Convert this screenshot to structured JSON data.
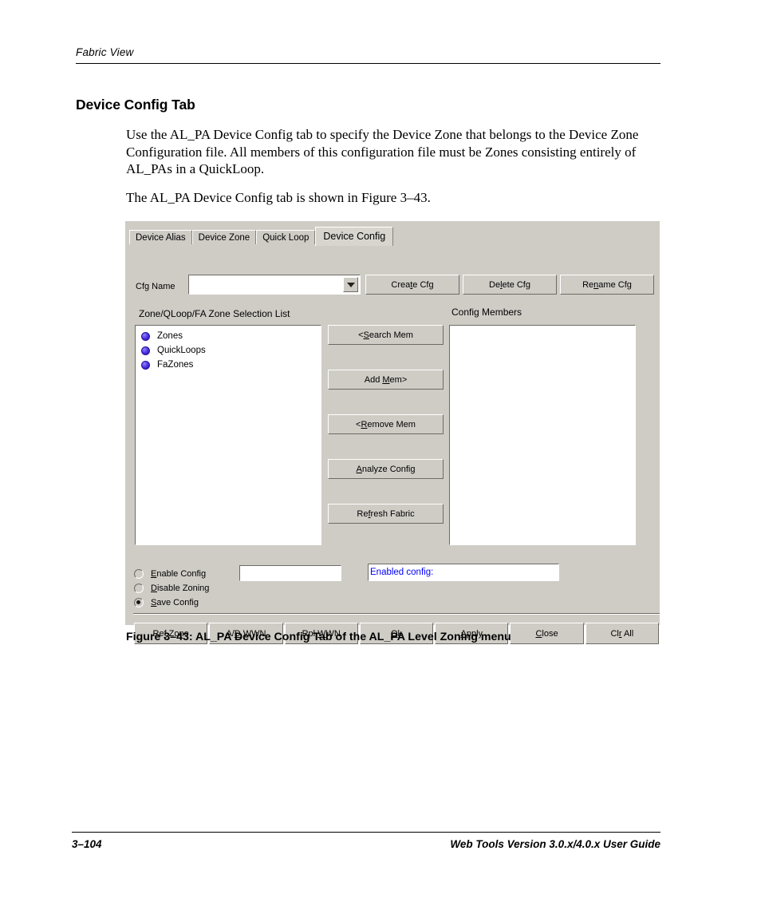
{
  "page": {
    "header": "Fabric View",
    "section_title": "Device Config Tab",
    "paragraphs": [
      "Use the AL_PA Device Config tab to specify the Device Zone that belongs to the Device Zone Configuration file. All members of this configuration file must be Zones consisting entirely of AL_PAs in a QuickLoop.",
      "The AL_PA Device Config tab is shown in Figure 3–43."
    ],
    "figure_caption": "Figure 3–43:  AL_PA Device Config Tab of the AL_PA Level Zoning menu",
    "footer_left": "3–104",
    "footer_right": "Web Tools Version 3.0.x/4.0.x User Guide"
  },
  "dialog": {
    "tabs": [
      {
        "label": "Device Alias",
        "active": false
      },
      {
        "label": "Device Zone",
        "active": false
      },
      {
        "label": "Quick Loop",
        "active": false
      },
      {
        "label": "Device Config",
        "active": true
      }
    ],
    "cfg_name": {
      "label": "Cfg Name",
      "value": "",
      "placeholder": "",
      "dropdown_icon": "chevron-down-icon"
    },
    "top_buttons": [
      {
        "label": "Create Cfg",
        "mnemonic": "t"
      },
      {
        "label": "Delete Cfg",
        "mnemonic": "l"
      },
      {
        "label": "Rename Cfg",
        "mnemonic": "n"
      }
    ],
    "selection_list": {
      "label": "Zone/QLoop/FA Zone Selection List",
      "items": [
        {
          "label": "Zones",
          "icon": "sphere-icon"
        },
        {
          "label": "QuickLoops",
          "icon": "sphere-icon"
        },
        {
          "label": "FaZones",
          "icon": "sphere-icon"
        }
      ]
    },
    "members": {
      "label": "Config Members",
      "items": []
    },
    "middle_buttons": [
      {
        "id": "search",
        "pre": "<",
        "mnemonic": "S",
        "post": "earch Mem"
      },
      {
        "id": "add",
        "pre": "Add ",
        "mnemonic": "M",
        "post": "em>"
      },
      {
        "id": "remove",
        "pre": "<",
        "mnemonic": "R",
        "post": "emove Mem"
      },
      {
        "id": "analyze",
        "pre": "",
        "mnemonic": "A",
        "post": "nalyze Config"
      },
      {
        "id": "refresh",
        "pre": "Re",
        "mnemonic": "f",
        "post": "resh Fabric"
      }
    ],
    "radios": [
      {
        "label_pre": "",
        "mnemonic": "E",
        "label_post": "nable Config",
        "checked": false
      },
      {
        "label_pre": "",
        "mnemonic": "D",
        "label_post": "isable Zoning",
        "checked": false
      },
      {
        "label_pre": "",
        "mnemonic": "S",
        "label_post": "ave Config",
        "checked": true
      }
    ],
    "enable_input": {
      "value": "",
      "placeholder": ""
    },
    "enabled_config": {
      "text": "Enabled config:",
      "color": "#0000ff"
    },
    "bottom_buttons": [
      {
        "pre": "Re",
        "mnemonic": "f",
        "post": " Zone"
      },
      {
        "pre": "A/",
        "mnemonic": "D",
        "post": " WWN"
      },
      {
        "pre": "Rpl ",
        "mnemonic": "W",
        "post": "WN"
      },
      {
        "pre": "",
        "mnemonic": "O",
        "post": "k"
      },
      {
        "pre": "",
        "mnemonic": "A",
        "post": "pply"
      },
      {
        "pre": "",
        "mnemonic": "C",
        "post": "lose"
      },
      {
        "pre": "Cl",
        "mnemonic": "r",
        "post": " All"
      }
    ]
  },
  "colors": {
    "dialog_face": "#cfccc6",
    "field_bg": "#ffffff",
    "status_text": "#0000ff",
    "bullet": "#4b2fe0"
  }
}
